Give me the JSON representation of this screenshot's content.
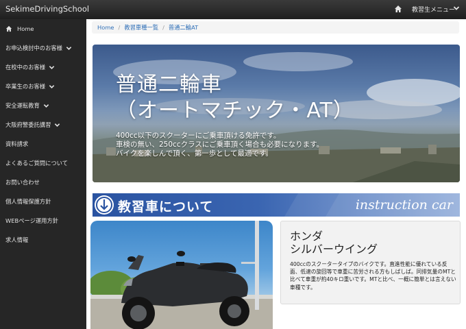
{
  "navbar": {
    "brand": "SekimeDrivingSchool",
    "home_icon": "home-icon",
    "menu_label": "教習生メニュー",
    "menu_icon": "chevron-down-icon"
  },
  "sidebar": {
    "items": [
      {
        "label": "Home",
        "icon": "home-icon",
        "has_dropdown": false
      },
      {
        "label": "お申込検討中のお客様",
        "has_dropdown": true
      },
      {
        "label": "在校中のお客様",
        "has_dropdown": true
      },
      {
        "label": "卒業生のお客様",
        "has_dropdown": true
      },
      {
        "label": "安全運転教育",
        "has_dropdown": true
      },
      {
        "label": "大阪府警委託講習",
        "has_dropdown": true
      },
      {
        "label": "資料請求",
        "has_dropdown": false
      },
      {
        "label": "よくあるご質問について",
        "has_dropdown": false
      },
      {
        "label": "お問い合わせ",
        "has_dropdown": false
      },
      {
        "label": "個人情報保護方針",
        "has_dropdown": false
      },
      {
        "label": "WEBページ運用方針",
        "has_dropdown": false
      },
      {
        "label": "求人情報",
        "has_dropdown": false
      }
    ]
  },
  "breadcrumb": {
    "items": [
      "Home",
      "教習車種一覧",
      "普通二輪AT"
    ],
    "separator": "/"
  },
  "hero": {
    "title_line1": "普通二輪車",
    "title_line2": "（オートマチック・AT）",
    "desc_line1": "400cc以下のスクーターにご乗車頂ける免許です。",
    "desc_line2": "車検の無い、250ccクラスにご乗車頂く場合も必要になります。",
    "desc_line3": "バイクを楽しんで頂く、第一歩として最適です。"
  },
  "section": {
    "title": "教習車について",
    "title_en": "instruction car",
    "icon": "arrow-circle-icon"
  },
  "card": {
    "title_line1": "ホンダ",
    "title_line2": "シルバーウイング",
    "body": "400ccのスクータータイプのバイクです。直進性能に優れている反面、低速の旋回等で車重に苦労される方もしばしば。同排気量のMTと比べて車重が約40キロ重いです。MTと比べ、一概に簡単とは言えない車種です。"
  },
  "colors": {
    "navbar": "#2b2b2b",
    "sidebar": "#262626",
    "link": "#2f6fb7",
    "banner": "#2a53a1"
  }
}
